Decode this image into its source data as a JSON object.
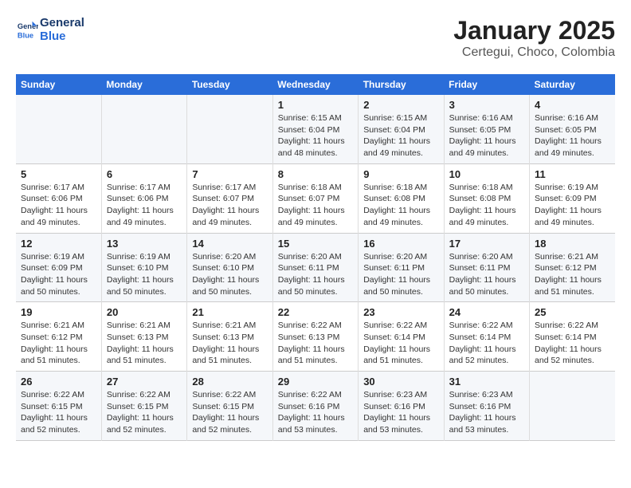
{
  "logo": {
    "general": "General",
    "blue": "Blue"
  },
  "title": "January 2025",
  "subtitle": "Certegui, Choco, Colombia",
  "headers": [
    "Sunday",
    "Monday",
    "Tuesday",
    "Wednesday",
    "Thursday",
    "Friday",
    "Saturday"
  ],
  "weeks": [
    [
      {
        "day": "",
        "lines": []
      },
      {
        "day": "",
        "lines": []
      },
      {
        "day": "",
        "lines": []
      },
      {
        "day": "1",
        "lines": [
          "Sunrise: 6:15 AM",
          "Sunset: 6:04 PM",
          "Daylight: 11 hours",
          "and 48 minutes."
        ]
      },
      {
        "day": "2",
        "lines": [
          "Sunrise: 6:15 AM",
          "Sunset: 6:04 PM",
          "Daylight: 11 hours",
          "and 49 minutes."
        ]
      },
      {
        "day": "3",
        "lines": [
          "Sunrise: 6:16 AM",
          "Sunset: 6:05 PM",
          "Daylight: 11 hours",
          "and 49 minutes."
        ]
      },
      {
        "day": "4",
        "lines": [
          "Sunrise: 6:16 AM",
          "Sunset: 6:05 PM",
          "Daylight: 11 hours",
          "and 49 minutes."
        ]
      }
    ],
    [
      {
        "day": "5",
        "lines": [
          "Sunrise: 6:17 AM",
          "Sunset: 6:06 PM",
          "Daylight: 11 hours",
          "and 49 minutes."
        ]
      },
      {
        "day": "6",
        "lines": [
          "Sunrise: 6:17 AM",
          "Sunset: 6:06 PM",
          "Daylight: 11 hours",
          "and 49 minutes."
        ]
      },
      {
        "day": "7",
        "lines": [
          "Sunrise: 6:17 AM",
          "Sunset: 6:07 PM",
          "Daylight: 11 hours",
          "and 49 minutes."
        ]
      },
      {
        "day": "8",
        "lines": [
          "Sunrise: 6:18 AM",
          "Sunset: 6:07 PM",
          "Daylight: 11 hours",
          "and 49 minutes."
        ]
      },
      {
        "day": "9",
        "lines": [
          "Sunrise: 6:18 AM",
          "Sunset: 6:08 PM",
          "Daylight: 11 hours",
          "and 49 minutes."
        ]
      },
      {
        "day": "10",
        "lines": [
          "Sunrise: 6:18 AM",
          "Sunset: 6:08 PM",
          "Daylight: 11 hours",
          "and 49 minutes."
        ]
      },
      {
        "day": "11",
        "lines": [
          "Sunrise: 6:19 AM",
          "Sunset: 6:09 PM",
          "Daylight: 11 hours",
          "and 49 minutes."
        ]
      }
    ],
    [
      {
        "day": "12",
        "lines": [
          "Sunrise: 6:19 AM",
          "Sunset: 6:09 PM",
          "Daylight: 11 hours",
          "and 50 minutes."
        ]
      },
      {
        "day": "13",
        "lines": [
          "Sunrise: 6:19 AM",
          "Sunset: 6:10 PM",
          "Daylight: 11 hours",
          "and 50 minutes."
        ]
      },
      {
        "day": "14",
        "lines": [
          "Sunrise: 6:20 AM",
          "Sunset: 6:10 PM",
          "Daylight: 11 hours",
          "and 50 minutes."
        ]
      },
      {
        "day": "15",
        "lines": [
          "Sunrise: 6:20 AM",
          "Sunset: 6:11 PM",
          "Daylight: 11 hours",
          "and 50 minutes."
        ]
      },
      {
        "day": "16",
        "lines": [
          "Sunrise: 6:20 AM",
          "Sunset: 6:11 PM",
          "Daylight: 11 hours",
          "and 50 minutes."
        ]
      },
      {
        "day": "17",
        "lines": [
          "Sunrise: 6:20 AM",
          "Sunset: 6:11 PM",
          "Daylight: 11 hours",
          "and 50 minutes."
        ]
      },
      {
        "day": "18",
        "lines": [
          "Sunrise: 6:21 AM",
          "Sunset: 6:12 PM",
          "Daylight: 11 hours",
          "and 51 minutes."
        ]
      }
    ],
    [
      {
        "day": "19",
        "lines": [
          "Sunrise: 6:21 AM",
          "Sunset: 6:12 PM",
          "Daylight: 11 hours",
          "and 51 minutes."
        ]
      },
      {
        "day": "20",
        "lines": [
          "Sunrise: 6:21 AM",
          "Sunset: 6:13 PM",
          "Daylight: 11 hours",
          "and 51 minutes."
        ]
      },
      {
        "day": "21",
        "lines": [
          "Sunrise: 6:21 AM",
          "Sunset: 6:13 PM",
          "Daylight: 11 hours",
          "and 51 minutes."
        ]
      },
      {
        "day": "22",
        "lines": [
          "Sunrise: 6:22 AM",
          "Sunset: 6:13 PM",
          "Daylight: 11 hours",
          "and 51 minutes."
        ]
      },
      {
        "day": "23",
        "lines": [
          "Sunrise: 6:22 AM",
          "Sunset: 6:14 PM",
          "Daylight: 11 hours",
          "and 51 minutes."
        ]
      },
      {
        "day": "24",
        "lines": [
          "Sunrise: 6:22 AM",
          "Sunset: 6:14 PM",
          "Daylight: 11 hours",
          "and 52 minutes."
        ]
      },
      {
        "day": "25",
        "lines": [
          "Sunrise: 6:22 AM",
          "Sunset: 6:14 PM",
          "Daylight: 11 hours",
          "and 52 minutes."
        ]
      }
    ],
    [
      {
        "day": "26",
        "lines": [
          "Sunrise: 6:22 AM",
          "Sunset: 6:15 PM",
          "Daylight: 11 hours",
          "and 52 minutes."
        ]
      },
      {
        "day": "27",
        "lines": [
          "Sunrise: 6:22 AM",
          "Sunset: 6:15 PM",
          "Daylight: 11 hours",
          "and 52 minutes."
        ]
      },
      {
        "day": "28",
        "lines": [
          "Sunrise: 6:22 AM",
          "Sunset: 6:15 PM",
          "Daylight: 11 hours",
          "and 52 minutes."
        ]
      },
      {
        "day": "29",
        "lines": [
          "Sunrise: 6:22 AM",
          "Sunset: 6:16 PM",
          "Daylight: 11 hours",
          "and 53 minutes."
        ]
      },
      {
        "day": "30",
        "lines": [
          "Sunrise: 6:23 AM",
          "Sunset: 6:16 PM",
          "Daylight: 11 hours",
          "and 53 minutes."
        ]
      },
      {
        "day": "31",
        "lines": [
          "Sunrise: 6:23 AM",
          "Sunset: 6:16 PM",
          "Daylight: 11 hours",
          "and 53 minutes."
        ]
      },
      {
        "day": "",
        "lines": []
      }
    ]
  ]
}
